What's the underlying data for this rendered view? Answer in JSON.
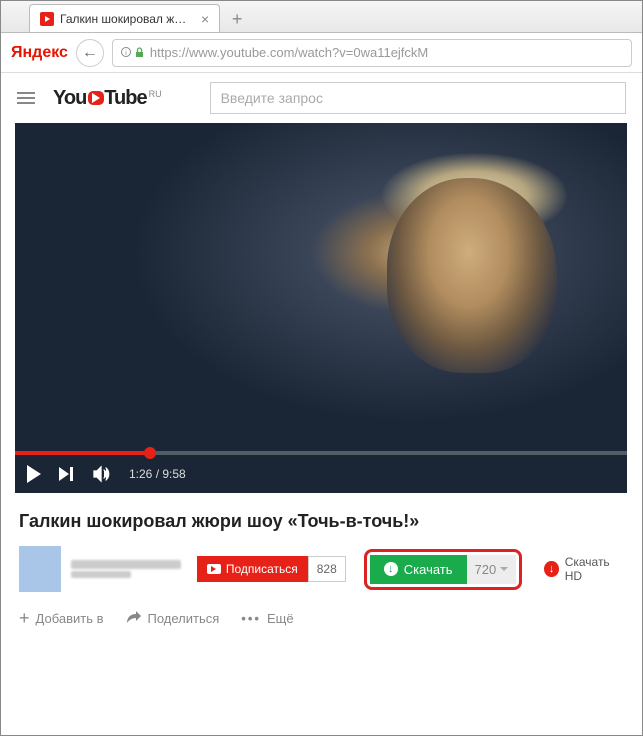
{
  "browser": {
    "tab_title": "Галкин шокировал жюр...",
    "yandex_label": "Яндекс",
    "url_prefix": "https://",
    "url_host": "www.youtube.com",
    "url_path": "/watch?v=0wa11ejfckM"
  },
  "header": {
    "logo_text": "YouTube",
    "logo_region": "RU",
    "search_placeholder": "Введите запрос"
  },
  "player": {
    "current_time": "1:26",
    "duration": "9:58"
  },
  "video": {
    "title": "Галкин шокировал жюри шоу «Точь-в-точь!»"
  },
  "channel": {
    "subscribe_label": "Подписаться",
    "subscriber_count": "828"
  },
  "download": {
    "button_label": "Скачать",
    "quality": "720",
    "hd_label": "Скачать HD",
    "hd_icon": "↓"
  },
  "actions": {
    "add": "Добавить в",
    "share": "Поделиться",
    "more": "Ещё"
  }
}
